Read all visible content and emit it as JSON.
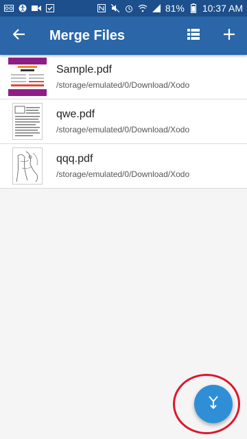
{
  "status_bar": {
    "battery": "81%",
    "time": "10:37 AM"
  },
  "toolbar": {
    "title": "Merge Files",
    "back_icon": "arrow-left-icon",
    "list_view_icon": "list-view-icon",
    "add_icon": "plus-icon"
  },
  "files": [
    {
      "name": "Sample.pdf",
      "path": "/storage/emulated/0/Download/Xodo"
    },
    {
      "name": "qwe.pdf",
      "path": "/storage/emulated/0/Download/Xodo"
    },
    {
      "name": "qqq.pdf",
      "path": "/storage/emulated/0/Download/Xodo"
    }
  ],
  "fab": {
    "icon": "merge-icon"
  },
  "colors": {
    "status_bar": "#1c4f8b",
    "toolbar": "#2a66a8",
    "fab": "#2f8fd6",
    "highlight": "#e0162b"
  }
}
